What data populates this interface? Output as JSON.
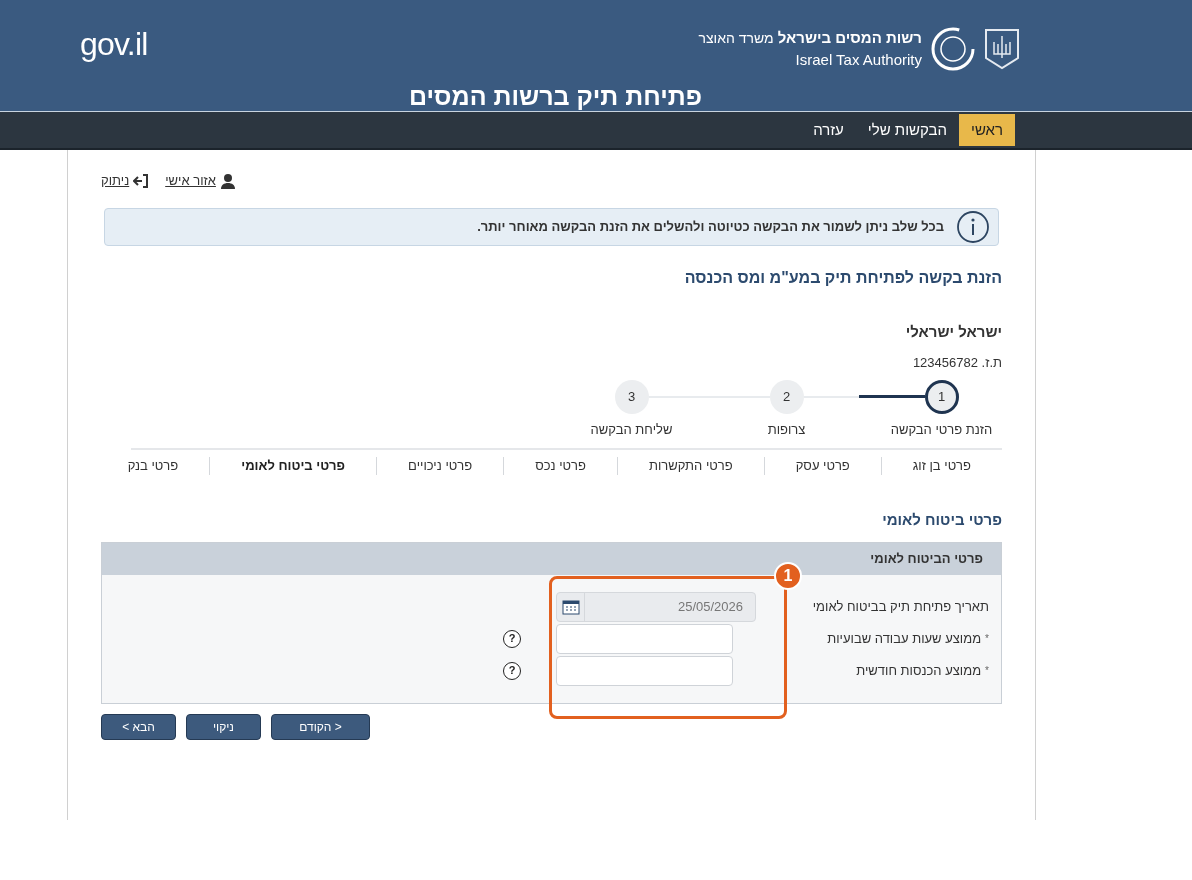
{
  "header": {
    "brand": "gov.il",
    "authority_he": "רשות המסים בישראל",
    "ministry": "משרד האוצר",
    "authority_en": "Israel Tax Authority",
    "title": "פתיחת תיק ברשות המסים"
  },
  "nav": [
    {
      "label": "ראשי",
      "selected": true
    },
    {
      "label": "הבקשות שלי",
      "selected": false
    },
    {
      "label": "עזרה",
      "selected": false
    }
  ],
  "user_links": [
    {
      "kind": "user",
      "label": "אזור אישי"
    },
    {
      "kind": "logout",
      "label": "ניתוק"
    }
  ],
  "info_message": "בכל שלב ניתן לשמור את הבקשה כטיוטה ולהשלים את הזנת הבקשה מאוחר יותר.",
  "page_title": "הזנת בקשה לפתיחת תיק במע\"מ ומס הכנסה",
  "applicant": {
    "name": "ישראל ישראלי",
    "id_label": "ת.ז. 123456782"
  },
  "steps": [
    {
      "number": "1",
      "label": "הזנת פרטי הבקשה",
      "selected": true
    },
    {
      "number": "2",
      "label": "צרופות",
      "selected": false
    },
    {
      "number": "3",
      "label": "שליחת הבקשה",
      "selected": false
    }
  ],
  "section_tabs": [
    {
      "label": "פרטי בן זוג",
      "selected": false
    },
    {
      "label": "פרטי עסק",
      "selected": false
    },
    {
      "label": "פרטי התקשרות",
      "selected": false
    },
    {
      "label": "פרטי נכס",
      "selected": false
    },
    {
      "label": "פרטי ניכויים",
      "selected": false
    },
    {
      "label": "פרטי ביטוח לאומי",
      "selected": true
    },
    {
      "label": "פרטי בנק",
      "selected": false
    }
  ],
  "section_title": "פרטי ביטוח לאומי",
  "panel": {
    "title": "פרטי הביטוח לאומי",
    "fields": [
      {
        "kind": "date",
        "label": "תאריך פתיחת תיק בביטוח לאומי",
        "value": "25/05/2026"
      },
      {
        "kind": "text",
        "label": "ממוצע שעות עבודה שבועיות",
        "required_mark": "*",
        "help": "?"
      },
      {
        "kind": "text",
        "label": "ממוצע הכנסות חודשית",
        "required_mark": "*",
        "help": "?"
      }
    ]
  },
  "callout": {
    "number": "1"
  },
  "buttons": [
    {
      "kind": "prev",
      "label": "< הקודם"
    },
    {
      "kind": "clear",
      "label": "ניקוי"
    },
    {
      "kind": "next",
      "label": "הבא >"
    }
  ]
}
